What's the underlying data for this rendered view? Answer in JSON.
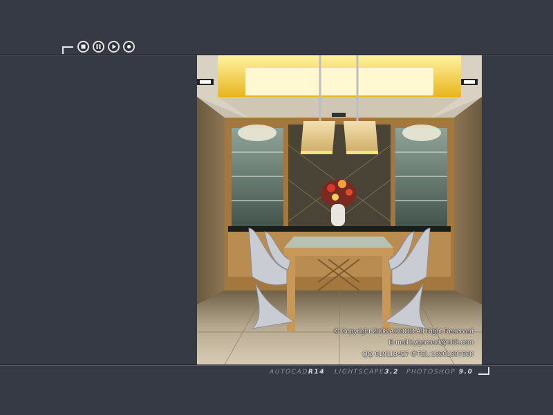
{
  "player": {
    "stop_icon": "stop-icon",
    "pause_icon": "pause-icon",
    "play_icon": "play-icon",
    "record_icon": "record-icon"
  },
  "credits": {
    "copyright": "© Copyright 2008 ACOOD  All Right Reserved",
    "email": "E-mail:Lygacood@163.com",
    "contact": "QQ 619113427 ✆TEL:13961397500"
  },
  "software": [
    {
      "name": "AUTOCAD",
      "version": "R14"
    },
    {
      "name": "LIGHTSCAPE",
      "version": "3.2"
    },
    {
      "name": "PHOTOSHOP",
      "version": "9.0"
    }
  ],
  "colors": {
    "background": "#363a45",
    "line": "#d9d9d9",
    "ceiling_glow": "#ffd700"
  }
}
